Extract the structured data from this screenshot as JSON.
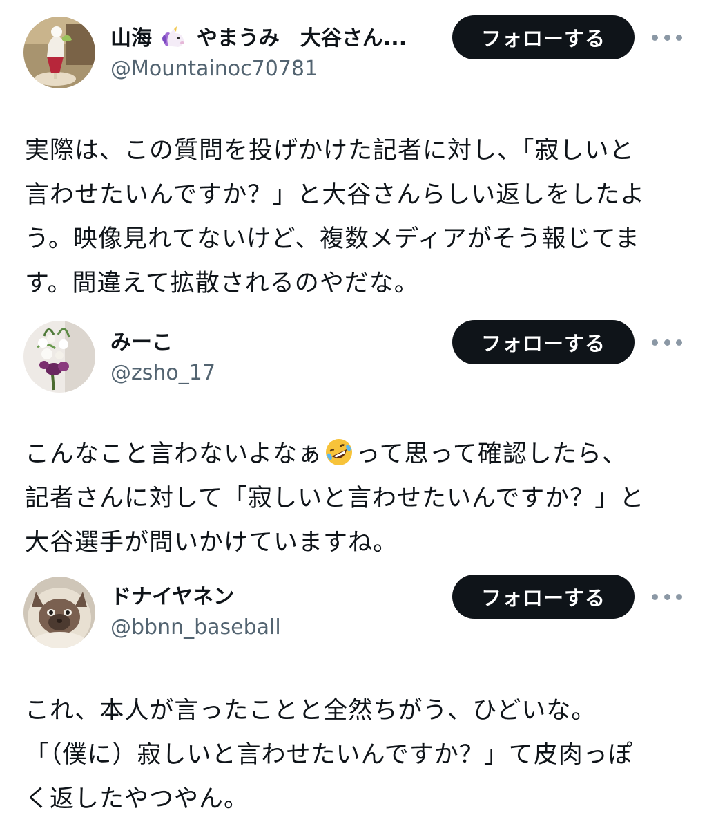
{
  "posts": [
    {
      "name_before_emoji": "山海",
      "name_emoji": "unicorn-emoji",
      "name_after_emoji": "やまうみ　大谷さん...",
      "handle": "@Mountainoc70781",
      "follow_label": "フォローする",
      "lines": [
        "実際は、この質問を投げかけた記者に対し、「寂しいと",
        "言わせたいんですか？」と大谷さんらしい返しをしたよ",
        "う。映像見れてないけど、複数メディアがそう報じてま",
        "す。間違えて拡散されるのやだな。"
      ]
    },
    {
      "name": "みーこ",
      "handle": "@zsho_17",
      "follow_label": "フォローする",
      "line1_before_emoji": "こんなこと言わないよなぁ",
      "line1_emoji": "rolling-on-floor-laughing-emoji",
      "line1_after_emoji": "って思って確認したら、",
      "lines": [
        "記者さんに対して「寂しいと言わせたいんですか？」と",
        "大谷選手が問いかけていますね。"
      ]
    },
    {
      "name": "ドナイヤネン",
      "handle": "@bbnn_baseball",
      "follow_label": "フォローする",
      "lines": [
        "これ、本人が言ったことと全然ちがう、ひどいな。",
        "「（僕に）寂しいと言わせたいんですか？」て皮肉っぽ",
        "く返したやつやん。"
      ]
    }
  ],
  "colors": {
    "text": "#0f1419",
    "secondary": "#536471",
    "button_bg": "#0f1419",
    "button_text": "#ffffff",
    "more_icon": "#8b98a5"
  },
  "icons": {
    "more": "more-horizontal-icon"
  }
}
